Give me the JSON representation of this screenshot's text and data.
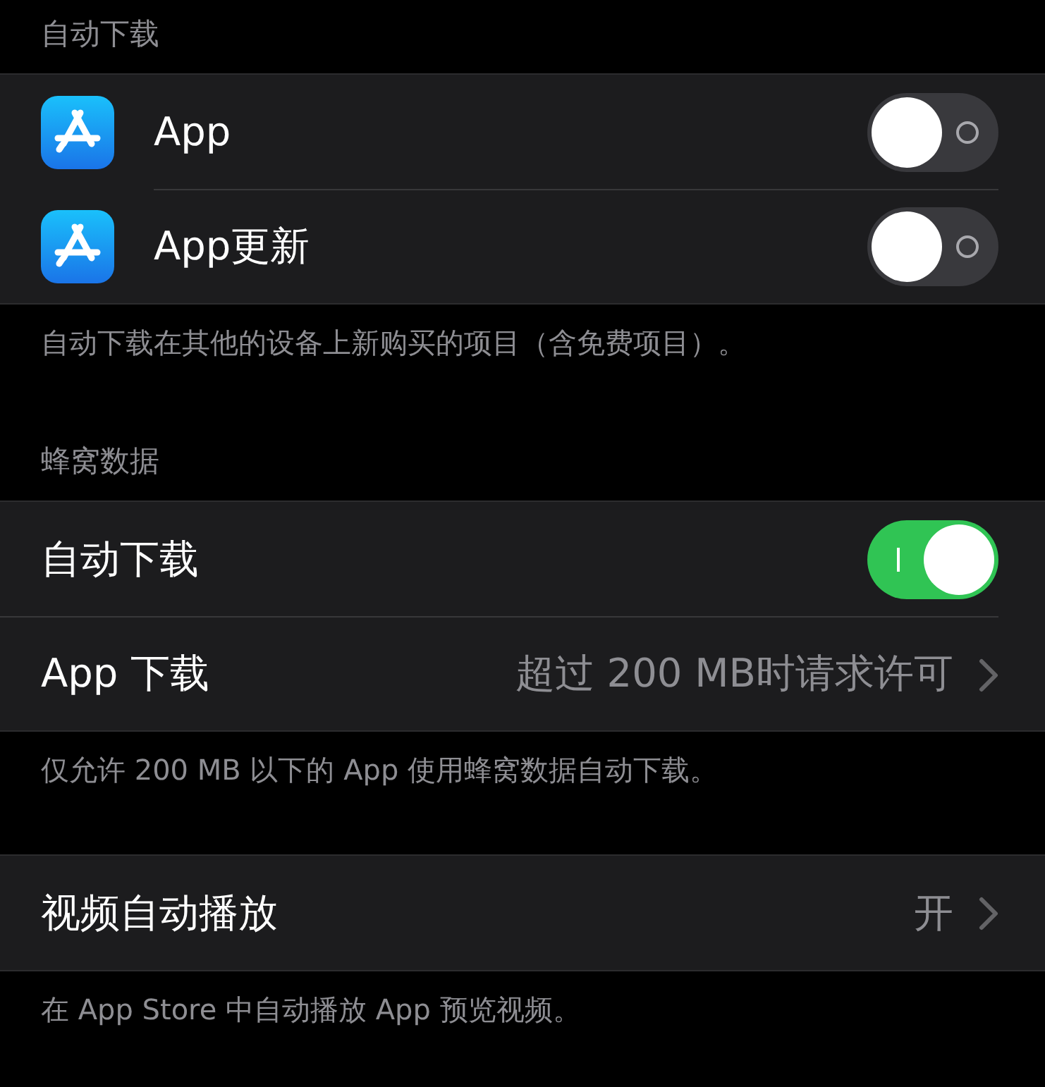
{
  "sections": [
    {
      "header": "自动下载",
      "rows": [
        {
          "kind": "toggle",
          "icon": true,
          "label": "App",
          "on": false
        },
        {
          "kind": "toggle",
          "icon": true,
          "label": "App更新",
          "on": false
        }
      ],
      "footer": "自动下载在其他的设备上新购买的项目（含免费项目）。"
    },
    {
      "header": "蜂窝数据",
      "rows": [
        {
          "kind": "toggle",
          "icon": false,
          "label": "自动下载",
          "on": true
        },
        {
          "kind": "disclosure",
          "icon": false,
          "label": "App 下载",
          "value": "超过 200 MB时请求许可"
        }
      ],
      "footer": "仅允许 200 MB 以下的 App 使用蜂窝数据自动下载。"
    },
    {
      "rows": [
        {
          "kind": "disclosure",
          "icon": false,
          "label": "视频自动播放",
          "value": "开"
        }
      ],
      "footer": "在 App Store 中自动播放 App 预览视频。"
    }
  ]
}
